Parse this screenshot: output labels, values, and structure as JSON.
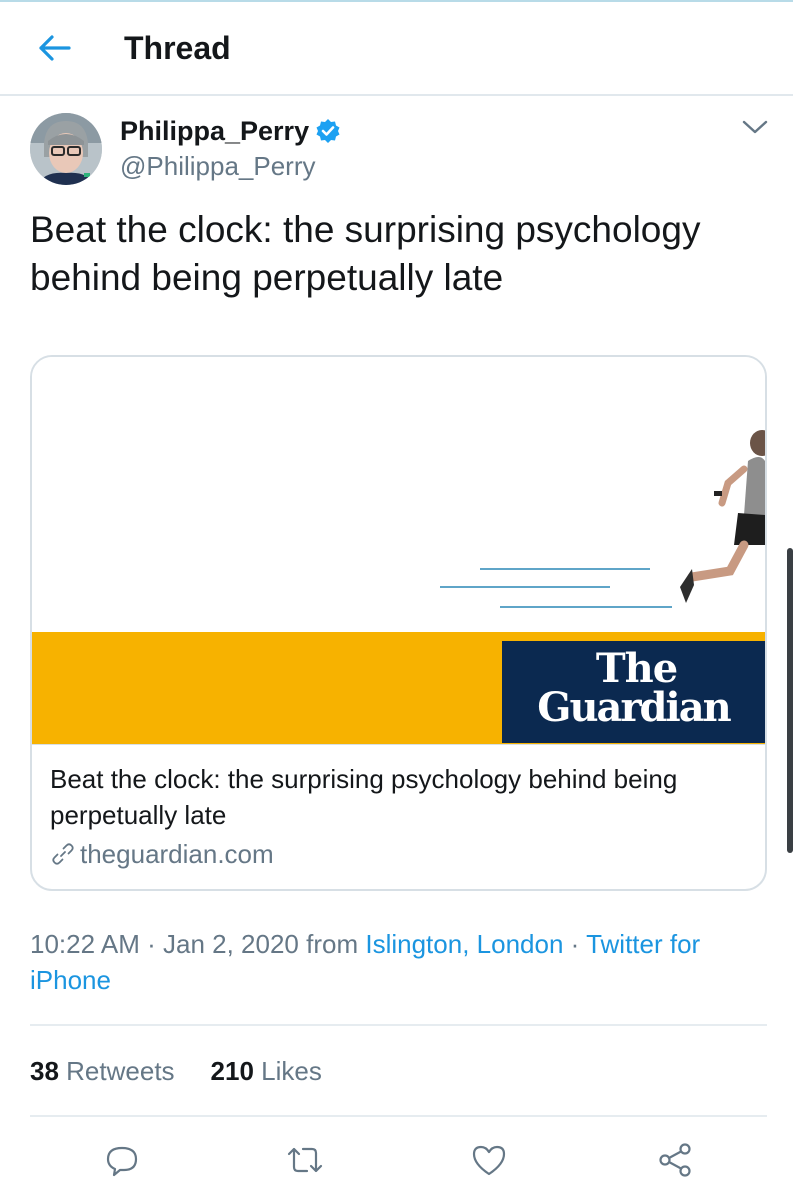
{
  "header": {
    "title": "Thread",
    "back_icon": "arrow-left-icon"
  },
  "tweet": {
    "author": {
      "display_name": "Philippa_Perry",
      "handle": "@Philippa_Perry",
      "verified": true
    },
    "text": "Beat the clock: the surprising psychology behind being perpetually late",
    "card": {
      "logo_line1": "The",
      "logo_line2": "Guardian",
      "title": "Beat the clock: the surprising psychology behind being perpetually late",
      "domain": "theguardian.com"
    },
    "meta": {
      "time": "10:22 AM",
      "date": "Jan 2, 2020",
      "from_label": "from",
      "location": "Islington, London",
      "source": "Twitter for iPhone",
      "separator": "·"
    },
    "stats": {
      "retweets_count": "38",
      "retweets_label": "Retweets",
      "likes_count": "210",
      "likes_label": "Likes"
    }
  },
  "actions": [
    "reply-icon",
    "retweet-icon",
    "like-icon",
    "share-icon"
  ],
  "colors": {
    "accent": "#1b95e0",
    "text": "#14171a",
    "secondary": "#657786",
    "guardian_navy": "#0b2950",
    "guardian_yellow": "#f7b200",
    "verified": "#1da1f2"
  }
}
